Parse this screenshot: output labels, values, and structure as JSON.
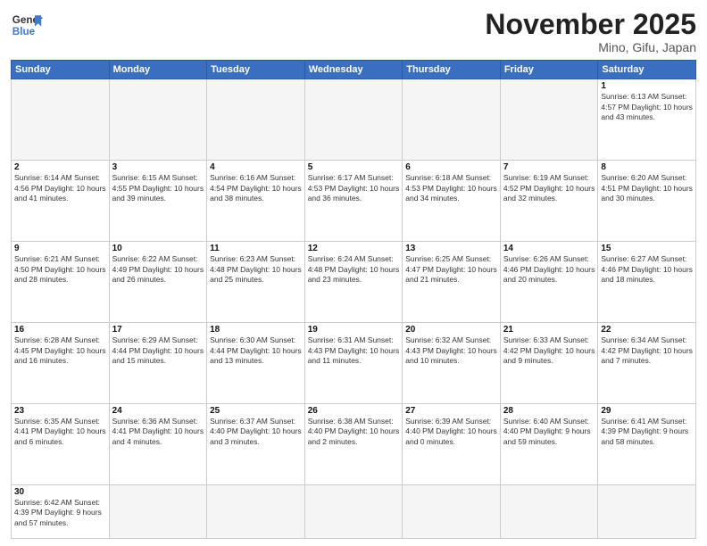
{
  "header": {
    "logo_general": "General",
    "logo_blue": "Blue",
    "title": "November 2025",
    "subtitle": "Mino, Gifu, Japan"
  },
  "weekdays": [
    "Sunday",
    "Monday",
    "Tuesday",
    "Wednesday",
    "Thursday",
    "Friday",
    "Saturday"
  ],
  "weeks": [
    [
      {
        "day": "",
        "info": ""
      },
      {
        "day": "",
        "info": ""
      },
      {
        "day": "",
        "info": ""
      },
      {
        "day": "",
        "info": ""
      },
      {
        "day": "",
        "info": ""
      },
      {
        "day": "",
        "info": ""
      },
      {
        "day": "1",
        "info": "Sunrise: 6:13 AM\nSunset: 4:57 PM\nDaylight: 10 hours\nand 43 minutes."
      }
    ],
    [
      {
        "day": "2",
        "info": "Sunrise: 6:14 AM\nSunset: 4:56 PM\nDaylight: 10 hours\nand 41 minutes."
      },
      {
        "day": "3",
        "info": "Sunrise: 6:15 AM\nSunset: 4:55 PM\nDaylight: 10 hours\nand 39 minutes."
      },
      {
        "day": "4",
        "info": "Sunrise: 6:16 AM\nSunset: 4:54 PM\nDaylight: 10 hours\nand 38 minutes."
      },
      {
        "day": "5",
        "info": "Sunrise: 6:17 AM\nSunset: 4:53 PM\nDaylight: 10 hours\nand 36 minutes."
      },
      {
        "day": "6",
        "info": "Sunrise: 6:18 AM\nSunset: 4:53 PM\nDaylight: 10 hours\nand 34 minutes."
      },
      {
        "day": "7",
        "info": "Sunrise: 6:19 AM\nSunset: 4:52 PM\nDaylight: 10 hours\nand 32 minutes."
      },
      {
        "day": "8",
        "info": "Sunrise: 6:20 AM\nSunset: 4:51 PM\nDaylight: 10 hours\nand 30 minutes."
      }
    ],
    [
      {
        "day": "9",
        "info": "Sunrise: 6:21 AM\nSunset: 4:50 PM\nDaylight: 10 hours\nand 28 minutes."
      },
      {
        "day": "10",
        "info": "Sunrise: 6:22 AM\nSunset: 4:49 PM\nDaylight: 10 hours\nand 26 minutes."
      },
      {
        "day": "11",
        "info": "Sunrise: 6:23 AM\nSunset: 4:48 PM\nDaylight: 10 hours\nand 25 minutes."
      },
      {
        "day": "12",
        "info": "Sunrise: 6:24 AM\nSunset: 4:48 PM\nDaylight: 10 hours\nand 23 minutes."
      },
      {
        "day": "13",
        "info": "Sunrise: 6:25 AM\nSunset: 4:47 PM\nDaylight: 10 hours\nand 21 minutes."
      },
      {
        "day": "14",
        "info": "Sunrise: 6:26 AM\nSunset: 4:46 PM\nDaylight: 10 hours\nand 20 minutes."
      },
      {
        "day": "15",
        "info": "Sunrise: 6:27 AM\nSunset: 4:46 PM\nDaylight: 10 hours\nand 18 minutes."
      }
    ],
    [
      {
        "day": "16",
        "info": "Sunrise: 6:28 AM\nSunset: 4:45 PM\nDaylight: 10 hours\nand 16 minutes."
      },
      {
        "day": "17",
        "info": "Sunrise: 6:29 AM\nSunset: 4:44 PM\nDaylight: 10 hours\nand 15 minutes."
      },
      {
        "day": "18",
        "info": "Sunrise: 6:30 AM\nSunset: 4:44 PM\nDaylight: 10 hours\nand 13 minutes."
      },
      {
        "day": "19",
        "info": "Sunrise: 6:31 AM\nSunset: 4:43 PM\nDaylight: 10 hours\nand 11 minutes."
      },
      {
        "day": "20",
        "info": "Sunrise: 6:32 AM\nSunset: 4:43 PM\nDaylight: 10 hours\nand 10 minutes."
      },
      {
        "day": "21",
        "info": "Sunrise: 6:33 AM\nSunset: 4:42 PM\nDaylight: 10 hours\nand 9 minutes."
      },
      {
        "day": "22",
        "info": "Sunrise: 6:34 AM\nSunset: 4:42 PM\nDaylight: 10 hours\nand 7 minutes."
      }
    ],
    [
      {
        "day": "23",
        "info": "Sunrise: 6:35 AM\nSunset: 4:41 PM\nDaylight: 10 hours\nand 6 minutes."
      },
      {
        "day": "24",
        "info": "Sunrise: 6:36 AM\nSunset: 4:41 PM\nDaylight: 10 hours\nand 4 minutes."
      },
      {
        "day": "25",
        "info": "Sunrise: 6:37 AM\nSunset: 4:40 PM\nDaylight: 10 hours\nand 3 minutes."
      },
      {
        "day": "26",
        "info": "Sunrise: 6:38 AM\nSunset: 4:40 PM\nDaylight: 10 hours\nand 2 minutes."
      },
      {
        "day": "27",
        "info": "Sunrise: 6:39 AM\nSunset: 4:40 PM\nDaylight: 10 hours\nand 0 minutes."
      },
      {
        "day": "28",
        "info": "Sunrise: 6:40 AM\nSunset: 4:40 PM\nDaylight: 9 hours\nand 59 minutes."
      },
      {
        "day": "29",
        "info": "Sunrise: 6:41 AM\nSunset: 4:39 PM\nDaylight: 9 hours\nand 58 minutes."
      }
    ],
    [
      {
        "day": "30",
        "info": "Sunrise: 6:42 AM\nSunset: 4:39 PM\nDaylight: 9 hours\nand 57 minutes."
      },
      {
        "day": "",
        "info": ""
      },
      {
        "day": "",
        "info": ""
      },
      {
        "day": "",
        "info": ""
      },
      {
        "day": "",
        "info": ""
      },
      {
        "day": "",
        "info": ""
      },
      {
        "day": "",
        "info": ""
      }
    ]
  ]
}
